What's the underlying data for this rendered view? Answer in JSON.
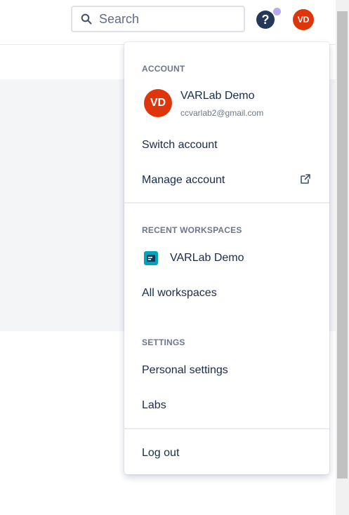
{
  "search": {
    "placeholder": "Search"
  },
  "header": {
    "help_glyph": "?",
    "avatar_initials": "VD"
  },
  "menu": {
    "account_title": "ACCOUNT",
    "account": {
      "initials": "VD",
      "name": "VARLab Demo",
      "email": "ccvarlab2@gmail.com"
    },
    "switch_account": "Switch account",
    "manage_account": "Manage account",
    "recent_workspaces_title": "RECENT WORKSPACES",
    "workspace_name": "VARLab Demo",
    "all_workspaces": "All workspaces",
    "settings_title": "SETTINGS",
    "personal_settings": "Personal settings",
    "labs": "Labs",
    "log_out": "Log out"
  },
  "icons": [
    "search-icon",
    "help-icon",
    "external-link-icon",
    "workspace-icon"
  ],
  "colors": {
    "avatar": "#de350b",
    "help": "#253858",
    "notification_dot": "#b8a9f0",
    "workspace_icon": "#00a3bf",
    "text": "#172b4d",
    "muted": "#6b778c"
  }
}
